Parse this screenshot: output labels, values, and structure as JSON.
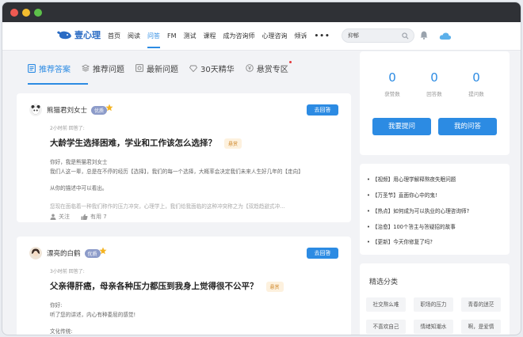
{
  "site": {
    "logo_text": "壹心理"
  },
  "nav": {
    "items": [
      "首页",
      "阅读",
      "问答",
      "FM",
      "测试",
      "课程",
      "成为咨询师",
      "心理咨询",
      "倾诉"
    ],
    "active_index": 2,
    "more": "•••"
  },
  "search": {
    "value": "抑郁"
  },
  "tabs": [
    {
      "label": "推荐答案",
      "icon": "document-icon"
    },
    {
      "label": "推荐问题",
      "icon": "layers-icon"
    },
    {
      "label": "最新问题",
      "icon": "image-icon"
    },
    {
      "label": "30天精华",
      "icon": "diamond-icon"
    },
    {
      "label": "悬赏专区",
      "icon": "yen-icon"
    }
  ],
  "questions": [
    {
      "user": "熊猫君刘女士",
      "badge": "优质",
      "button": "去回答",
      "meta": "2小时前 回答了:",
      "title": "大龄学生选择困难，学业和工作该怎么选择？",
      "tag": "悬赏",
      "lines": [
        "你好，我是熊猫君刘女士",
        "我们人这一辈，总是在不停的经历【选择】，我们的每一个选择，大概率会决定我们未来人生好几年的【走向】",
        "",
        "从你的描述中可以看出。",
        "",
        "您现在面临着一种我们称作的压力冲突，心理学上，我们给我面临的这种冲突称之为【双趋趋避式冲..."
      ],
      "follow": "关注",
      "useful": "有用 7"
    },
    {
      "user": "漂亮的白鹤",
      "badge": "优质",
      "button": "去回答",
      "meta": "3小时前 回答了:",
      "title": "父亲得肝癌，母亲各种压力都压到我身上觉得很不公平？",
      "tag": "悬赏",
      "lines": [
        "你好:",
        "听了您的讲述，内心有种委屈的感觉!",
        "",
        "文化传统:"
      ]
    }
  ],
  "stats": [
    {
      "value": "0",
      "label": "获赞数"
    },
    {
      "value": "0",
      "label": "回答数"
    },
    {
      "value": "0",
      "label": "提问数"
    }
  ],
  "actions": {
    "ask": "我要提问",
    "mine": "我的问答"
  },
  "hot_list": [
    "【视频】用心理学解释熬夜失眠问题",
    "【万圣节】直面你心中的鬼!",
    "【热点】如何成为可以执业的心理咨询师?",
    "【治愈】100个答主与答疑招的故事",
    "【更新】今天你修复了吗?"
  ],
  "categories": {
    "title": "精选分类",
    "chips": [
      "社交熬么难",
      "职场的压力",
      "青春的迷茫",
      "不喜欢自己",
      "情绪知潮水",
      "啊，是爱情"
    ]
  },
  "colors": {
    "accent": "#2c8be3",
    "tag": "#d08a2e"
  }
}
